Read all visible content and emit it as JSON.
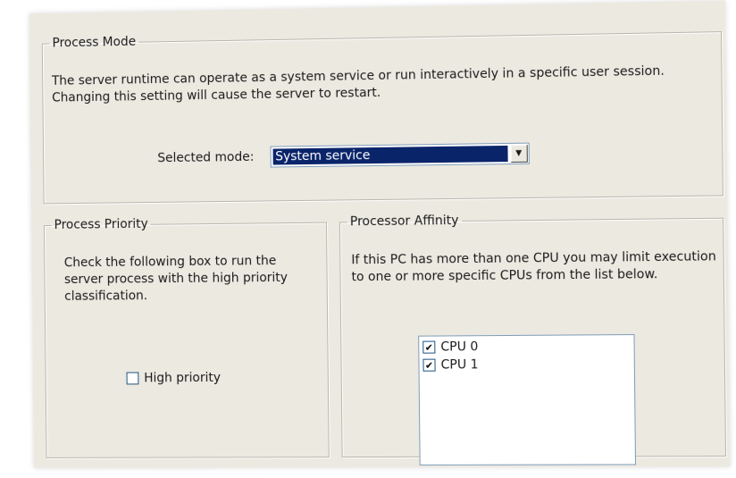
{
  "process_mode": {
    "legend": "Process Mode",
    "description": "The server runtime can operate as a system service or run interactively in a specific user session.  Changing this setting will cause the server to restart.",
    "selected_mode_label": "Selected mode:",
    "selected_mode_value": "System service"
  },
  "process_priority": {
    "legend": "Process Priority",
    "description": "Check the following box to run the server process with the high priority classification.",
    "checkbox_label": "High priority",
    "checked": false
  },
  "processor_affinity": {
    "legend": "Processor Affinity",
    "description": "If this PC has more than one CPU you may limit execution to one or more specific CPUs from the list below.",
    "cpus": [
      {
        "label": "CPU 0",
        "checked": true
      },
      {
        "label": "CPU 1",
        "checked": true
      }
    ]
  }
}
